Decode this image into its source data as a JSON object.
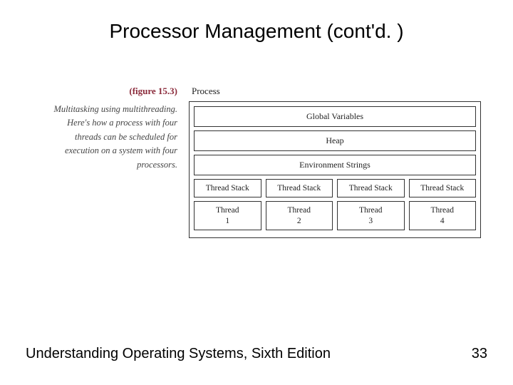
{
  "title": "Processor Management (cont'd. )",
  "figure": {
    "label": "(figure 15.3)",
    "caption": "Multitasking using multithreading. Here's how a process with four threads can be scheduled for execution on a system with four processors.",
    "process_label": "Process",
    "segments": {
      "global": "Global Variables",
      "heap": "Heap",
      "env": "Environment Strings"
    },
    "threads": [
      {
        "stack": "Thread Stack",
        "name": "Thread",
        "num": "1"
      },
      {
        "stack": "Thread Stack",
        "name": "Thread",
        "num": "2"
      },
      {
        "stack": "Thread Stack",
        "name": "Thread",
        "num": "3"
      },
      {
        "stack": "Thread Stack",
        "name": "Thread",
        "num": "4"
      }
    ]
  },
  "footer": {
    "book": "Understanding Operating Systems, Sixth Edition",
    "page": "33"
  }
}
